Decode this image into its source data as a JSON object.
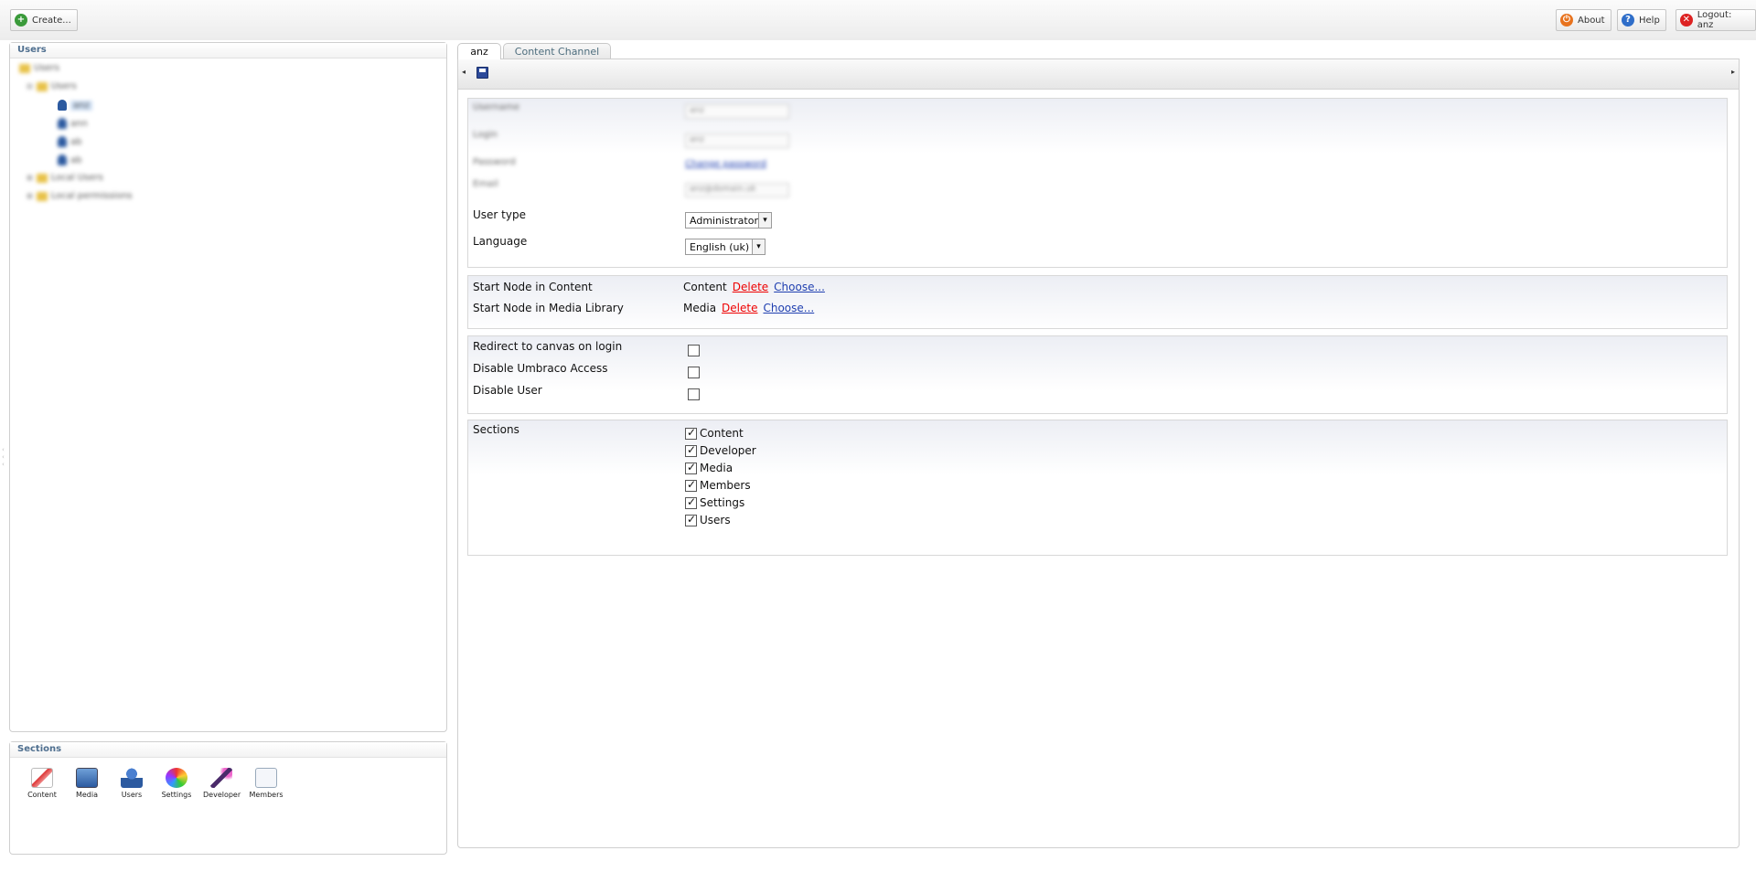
{
  "topbar": {
    "create_label": "Create...",
    "about_label": "About",
    "help_label": "Help",
    "logout_label": "Logout: anz"
  },
  "tree_panel": {
    "title": "Users",
    "nodes": [
      "Users",
      "Users",
      "anz",
      "ann",
      "ab",
      "ab",
      "Local Users",
      "Local permissions"
    ]
  },
  "sections_panel": {
    "title": "Sections",
    "items": [
      {
        "label": "Content",
        "icon": "content-icon"
      },
      {
        "label": "Media",
        "icon": "media-icon"
      },
      {
        "label": "Users",
        "icon": "users-icon"
      },
      {
        "label": "Settings",
        "icon": "settings-icon"
      },
      {
        "label": "Developer",
        "icon": "developer-icon"
      },
      {
        "label": "Members",
        "icon": "members-icon"
      }
    ]
  },
  "tabs": [
    {
      "label": "anz"
    },
    {
      "label": "Content Channel"
    }
  ],
  "form": {
    "username_label": "Username",
    "username_value": "anz",
    "login_label": "Login",
    "login_value": "anz",
    "password_label": "Password",
    "password_link": "Change password",
    "email_label": "Email",
    "email_value": "anz@domain.uk",
    "user_type_label": "User type",
    "user_type_value": "Administrator",
    "language_label": "Language",
    "language_value": "English (uk)",
    "start_content_label": "Start Node in Content",
    "start_content_value": "Content",
    "start_media_label": "Start Node in Media Library",
    "start_media_value": "Media",
    "delete_label": "Delete",
    "choose_label": "Choose...",
    "redirect_label": "Redirect to canvas on login",
    "disable_access_label": "Disable Umbraco Access",
    "disable_user_label": "Disable User",
    "sections_label": "Sections",
    "section_checks": [
      "Content",
      "Developer",
      "Media",
      "Members",
      "Settings",
      "Users"
    ]
  }
}
